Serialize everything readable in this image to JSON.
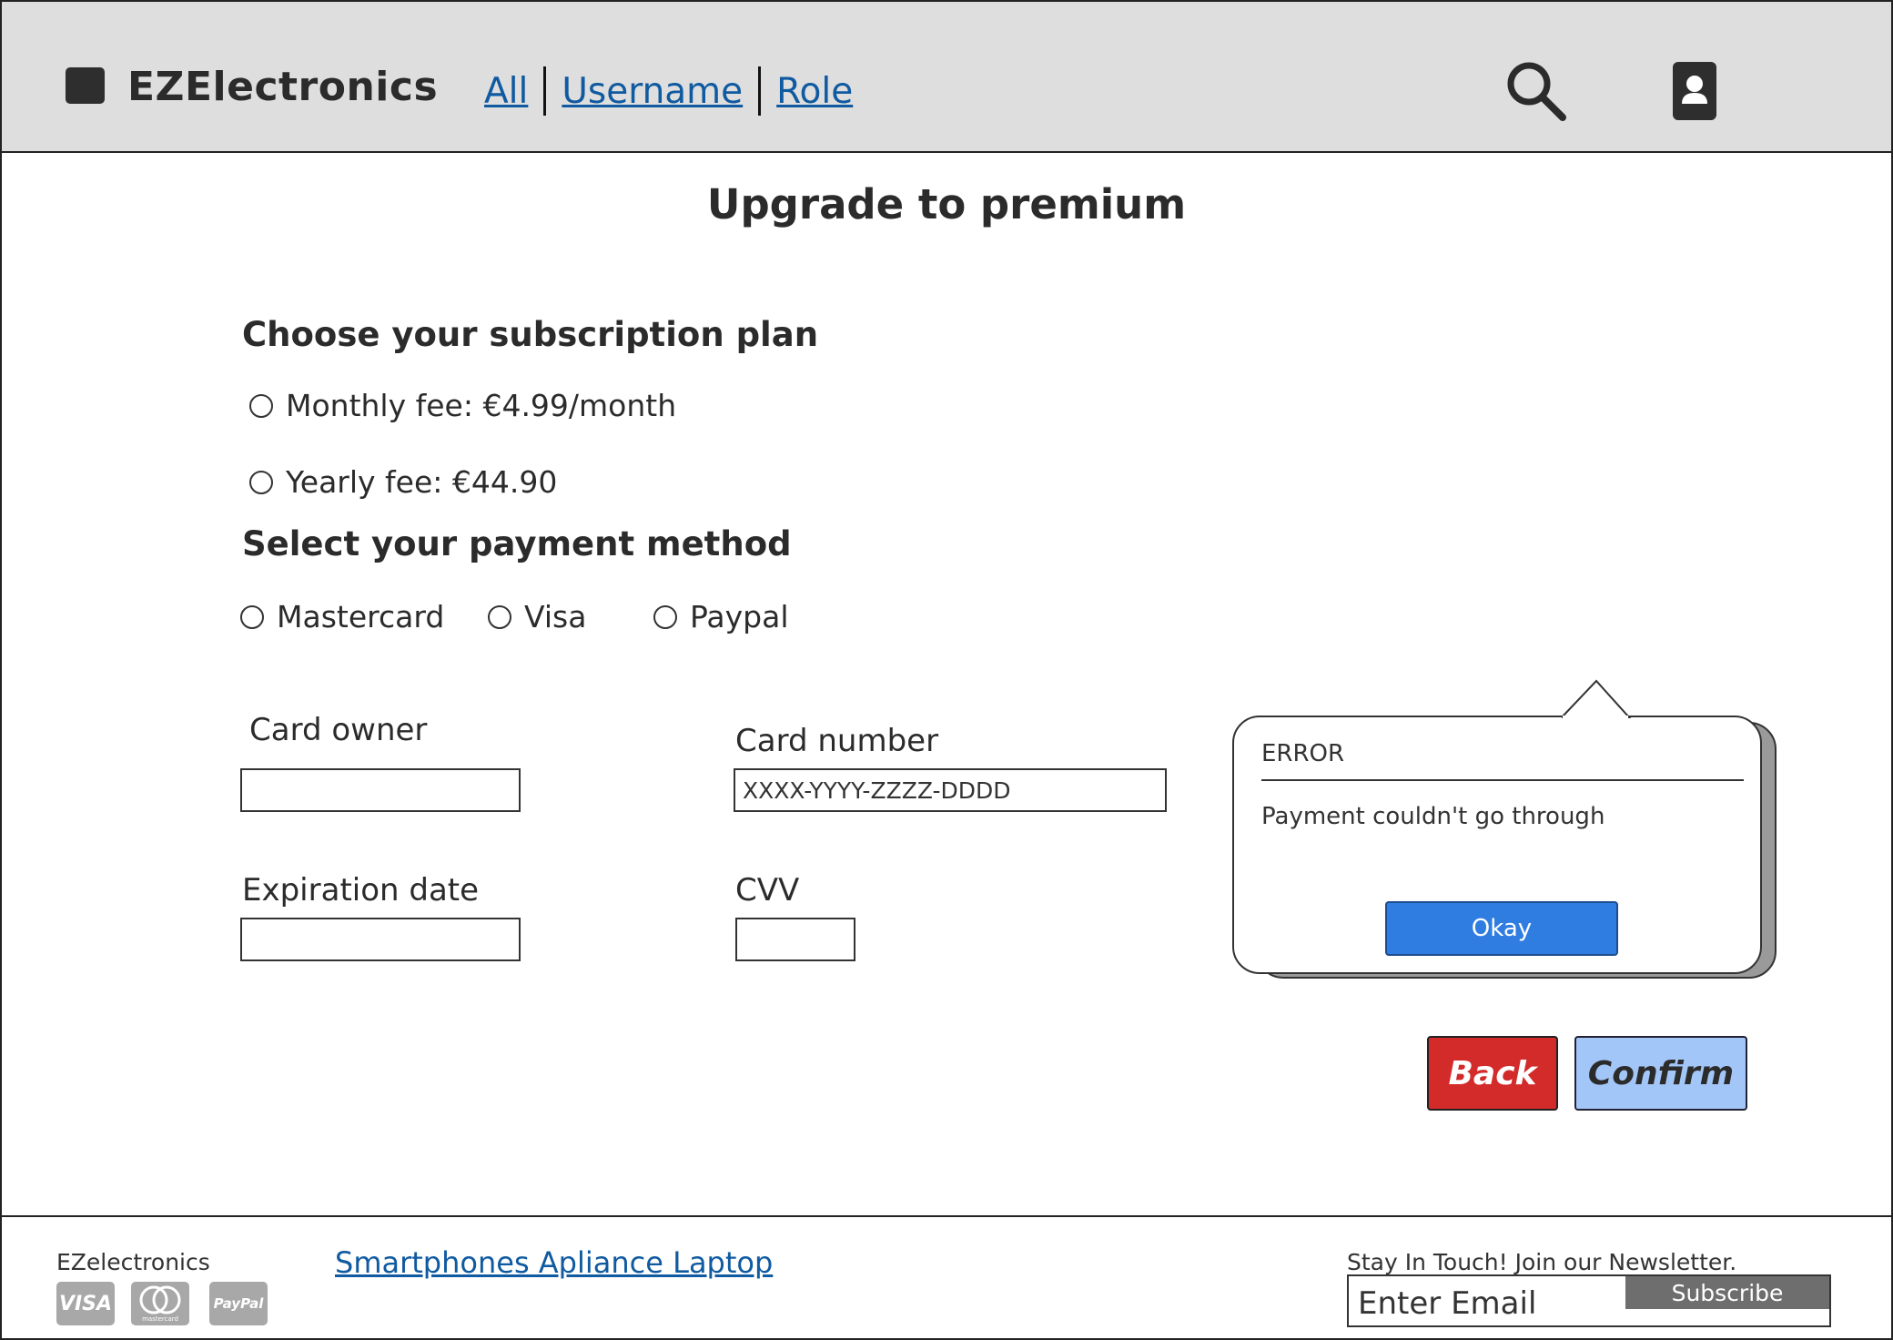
{
  "header": {
    "brand": "EZElectronics",
    "nav": [
      "All",
      "Username",
      "Role"
    ]
  },
  "page": {
    "title": "Upgrade to premium"
  },
  "subscription": {
    "heading": "Choose your subscription plan",
    "options": [
      "Monthly fee: €4.99/month",
      "Yearly fee: €44.90"
    ]
  },
  "payment": {
    "heading": "Select your payment method",
    "options": [
      "Mastercard",
      "Visa",
      "Paypal"
    ]
  },
  "form": {
    "card_owner_label": "Card owner",
    "card_owner_value": "",
    "card_number_label": "Card number",
    "card_number_value": "XXXX-YYYY-ZZZZ-DDDD",
    "expiration_label": "Expiration date",
    "expiration_value": "",
    "cvv_label": "CVV",
    "cvv_value": ""
  },
  "error_popup": {
    "title": "ERROR",
    "message": "Payment couldn't go through",
    "button": "Okay"
  },
  "actions": {
    "back": "Back",
    "confirm": "Confirm"
  },
  "footer": {
    "brand": "EZelectronics",
    "payment_logos": [
      "VISA",
      "mastercard",
      "PayPal"
    ],
    "links": "Smartphones Apliance Laptop",
    "newsletter_label": "Stay In Touch! Join our Newsletter.",
    "email_placeholder": "Enter Email",
    "subscribe": "Subscribe"
  },
  "colors": {
    "header_bg": "#dedede",
    "link": "#0f5aa0",
    "okay_button": "#2f7de1",
    "back_button": "#d32a2a",
    "confirm_button": "#a3c6f8"
  }
}
